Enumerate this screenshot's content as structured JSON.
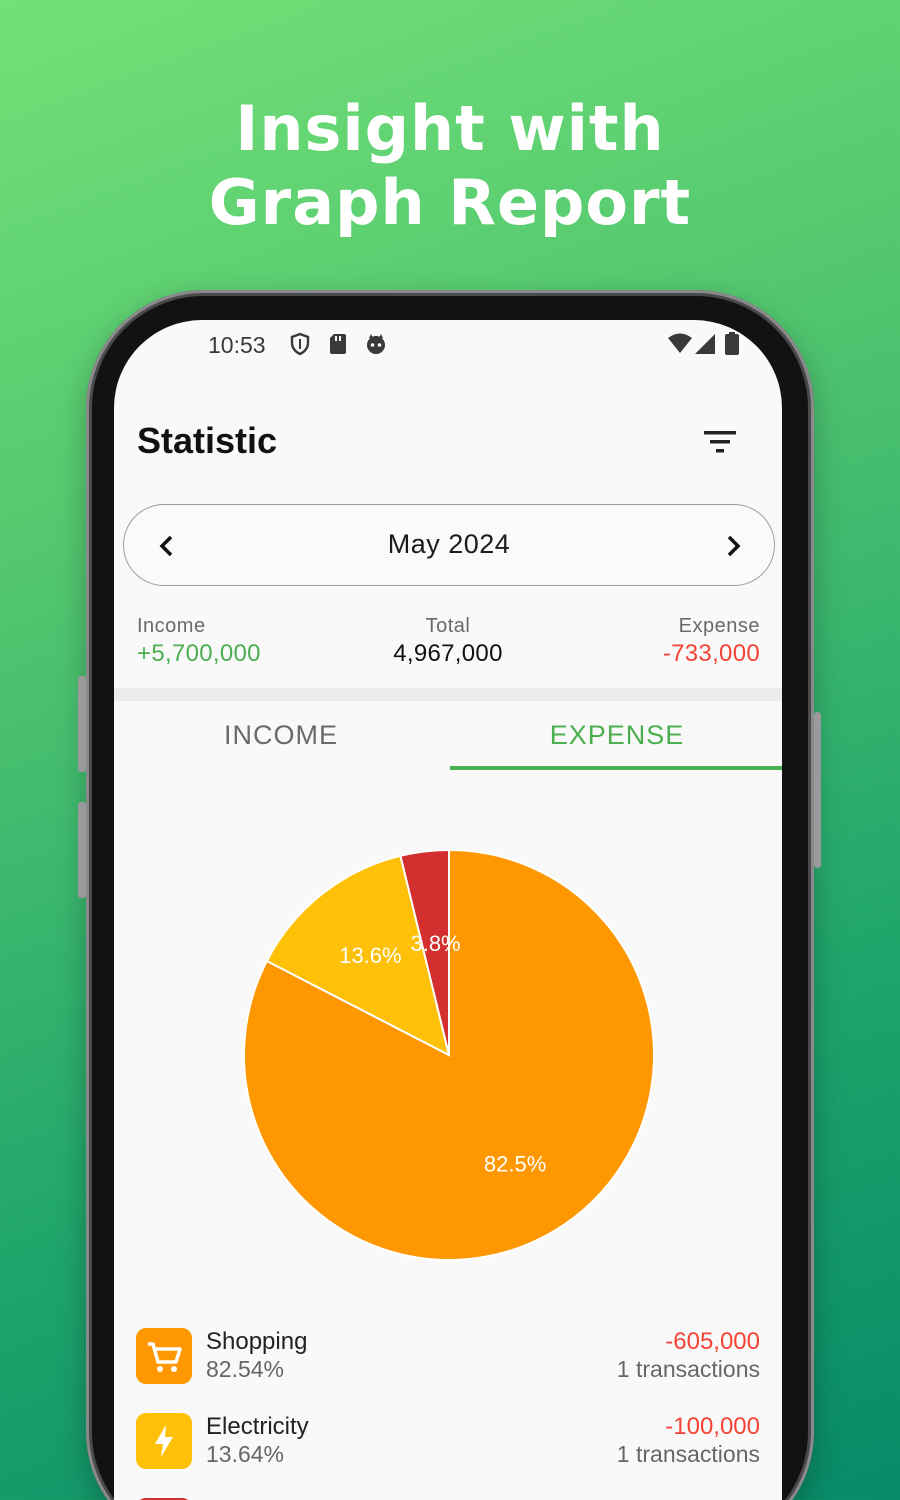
{
  "headline": {
    "line1": "Insight with",
    "line2": "Graph Report"
  },
  "status_bar": {
    "time": "10:53",
    "left_icons": [
      "shield-icon",
      "sd-card-icon",
      "cat-face-icon"
    ],
    "right_icons": [
      "wifi-icon",
      "signal-icon",
      "battery-icon"
    ]
  },
  "app": {
    "title": "Statistic",
    "filter_icon": "filter-icon"
  },
  "month_picker": {
    "label": "May 2024"
  },
  "summary": {
    "income_label": "Income",
    "income_value": "+5,700,000",
    "total_label": "Total",
    "total_value": "4,967,000",
    "expense_label": "Expense",
    "expense_value": "-733,000"
  },
  "tabs": [
    {
      "label": "INCOME",
      "active": false
    },
    {
      "label": "EXPENSE",
      "active": true
    }
  ],
  "colors": {
    "accent": "#4caf50",
    "income": "#4caf50",
    "expense": "#f44336",
    "shopping": "#ff9800",
    "electricity": "#ffc107",
    "third_category": "#d32f2f"
  },
  "chart_data": {
    "type": "pie",
    "labels": [
      "82.5%",
      "13.6%",
      "3.8%"
    ],
    "values": [
      82.5,
      13.6,
      3.8
    ],
    "colors": [
      "#ff9800",
      "#ffc107",
      "#d32f2f"
    ]
  },
  "categories": [
    {
      "name": "Shopping",
      "percent": "82.54%",
      "amount": "-605,000",
      "transactions": "1 transactions",
      "icon": "cart-icon"
    },
    {
      "name": "Electricity",
      "percent": "13.64%",
      "amount": "-100,000",
      "transactions": "1 transactions",
      "icon": "lightning-icon"
    }
  ]
}
